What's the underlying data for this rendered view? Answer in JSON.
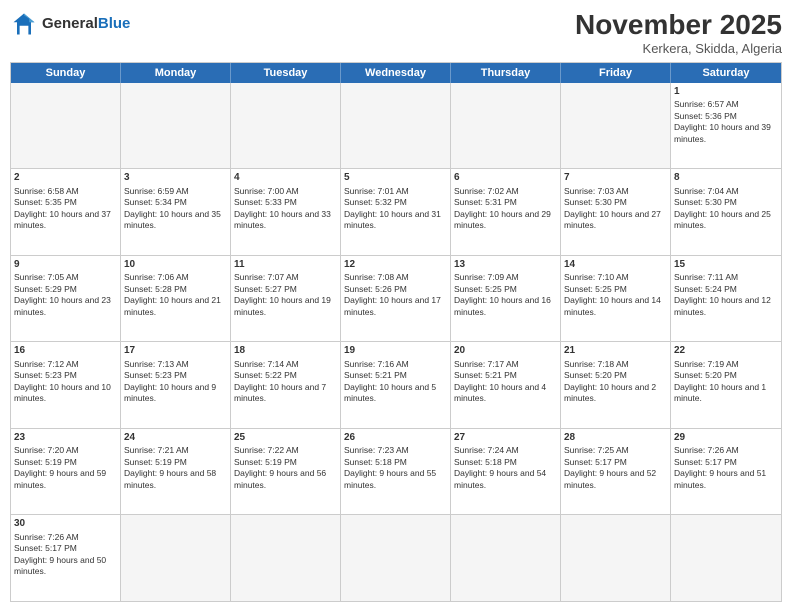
{
  "logo": {
    "general": "General",
    "blue": "Blue"
  },
  "title": "November 2025",
  "subtitle": "Kerkera, Skidda, Algeria",
  "dayHeaders": [
    "Sunday",
    "Monday",
    "Tuesday",
    "Wednesday",
    "Thursday",
    "Friday",
    "Saturday"
  ],
  "weeks": [
    [
      {
        "day": "",
        "empty": true
      },
      {
        "day": "",
        "empty": true
      },
      {
        "day": "",
        "empty": true
      },
      {
        "day": "",
        "empty": true
      },
      {
        "day": "",
        "empty": true
      },
      {
        "day": "",
        "empty": true
      },
      {
        "day": "1",
        "sunrise": "6:57 AM",
        "sunset": "5:36 PM",
        "daylight": "10 hours and 39 minutes."
      }
    ],
    [
      {
        "day": "2",
        "sunrise": "6:58 AM",
        "sunset": "5:35 PM",
        "daylight": "10 hours and 37 minutes."
      },
      {
        "day": "3",
        "sunrise": "6:59 AM",
        "sunset": "5:34 PM",
        "daylight": "10 hours and 35 minutes."
      },
      {
        "day": "4",
        "sunrise": "7:00 AM",
        "sunset": "5:33 PM",
        "daylight": "10 hours and 33 minutes."
      },
      {
        "day": "5",
        "sunrise": "7:01 AM",
        "sunset": "5:32 PM",
        "daylight": "10 hours and 31 minutes."
      },
      {
        "day": "6",
        "sunrise": "7:02 AM",
        "sunset": "5:31 PM",
        "daylight": "10 hours and 29 minutes."
      },
      {
        "day": "7",
        "sunrise": "7:03 AM",
        "sunset": "5:30 PM",
        "daylight": "10 hours and 27 minutes."
      },
      {
        "day": "8",
        "sunrise": "7:04 AM",
        "sunset": "5:30 PM",
        "daylight": "10 hours and 25 minutes."
      }
    ],
    [
      {
        "day": "9",
        "sunrise": "7:05 AM",
        "sunset": "5:29 PM",
        "daylight": "10 hours and 23 minutes."
      },
      {
        "day": "10",
        "sunrise": "7:06 AM",
        "sunset": "5:28 PM",
        "daylight": "10 hours and 21 minutes."
      },
      {
        "day": "11",
        "sunrise": "7:07 AM",
        "sunset": "5:27 PM",
        "daylight": "10 hours and 19 minutes."
      },
      {
        "day": "12",
        "sunrise": "7:08 AM",
        "sunset": "5:26 PM",
        "daylight": "10 hours and 17 minutes."
      },
      {
        "day": "13",
        "sunrise": "7:09 AM",
        "sunset": "5:25 PM",
        "daylight": "10 hours and 16 minutes."
      },
      {
        "day": "14",
        "sunrise": "7:10 AM",
        "sunset": "5:25 PM",
        "daylight": "10 hours and 14 minutes."
      },
      {
        "day": "15",
        "sunrise": "7:11 AM",
        "sunset": "5:24 PM",
        "daylight": "10 hours and 12 minutes."
      }
    ],
    [
      {
        "day": "16",
        "sunrise": "7:12 AM",
        "sunset": "5:23 PM",
        "daylight": "10 hours and 10 minutes."
      },
      {
        "day": "17",
        "sunrise": "7:13 AM",
        "sunset": "5:23 PM",
        "daylight": "10 hours and 9 minutes."
      },
      {
        "day": "18",
        "sunrise": "7:14 AM",
        "sunset": "5:22 PM",
        "daylight": "10 hours and 7 minutes."
      },
      {
        "day": "19",
        "sunrise": "7:16 AM",
        "sunset": "5:21 PM",
        "daylight": "10 hours and 5 minutes."
      },
      {
        "day": "20",
        "sunrise": "7:17 AM",
        "sunset": "5:21 PM",
        "daylight": "10 hours and 4 minutes."
      },
      {
        "day": "21",
        "sunrise": "7:18 AM",
        "sunset": "5:20 PM",
        "daylight": "10 hours and 2 minutes."
      },
      {
        "day": "22",
        "sunrise": "7:19 AM",
        "sunset": "5:20 PM",
        "daylight": "10 hours and 1 minute."
      }
    ],
    [
      {
        "day": "23",
        "sunrise": "7:20 AM",
        "sunset": "5:19 PM",
        "daylight": "9 hours and 59 minutes."
      },
      {
        "day": "24",
        "sunrise": "7:21 AM",
        "sunset": "5:19 PM",
        "daylight": "9 hours and 58 minutes."
      },
      {
        "day": "25",
        "sunrise": "7:22 AM",
        "sunset": "5:19 PM",
        "daylight": "9 hours and 56 minutes."
      },
      {
        "day": "26",
        "sunrise": "7:23 AM",
        "sunset": "5:18 PM",
        "daylight": "9 hours and 55 minutes."
      },
      {
        "day": "27",
        "sunrise": "7:24 AM",
        "sunset": "5:18 PM",
        "daylight": "9 hours and 54 minutes."
      },
      {
        "day": "28",
        "sunrise": "7:25 AM",
        "sunset": "5:17 PM",
        "daylight": "9 hours and 52 minutes."
      },
      {
        "day": "29",
        "sunrise": "7:26 AM",
        "sunset": "5:17 PM",
        "daylight": "9 hours and 51 minutes."
      }
    ],
    [
      {
        "day": "30",
        "sunrise": "7:26 AM",
        "sunset": "5:17 PM",
        "daylight": "9 hours and 50 minutes."
      },
      {
        "day": "",
        "empty": true
      },
      {
        "day": "",
        "empty": true
      },
      {
        "day": "",
        "empty": true
      },
      {
        "day": "",
        "empty": true
      },
      {
        "day": "",
        "empty": true
      },
      {
        "day": "",
        "empty": true
      }
    ]
  ]
}
